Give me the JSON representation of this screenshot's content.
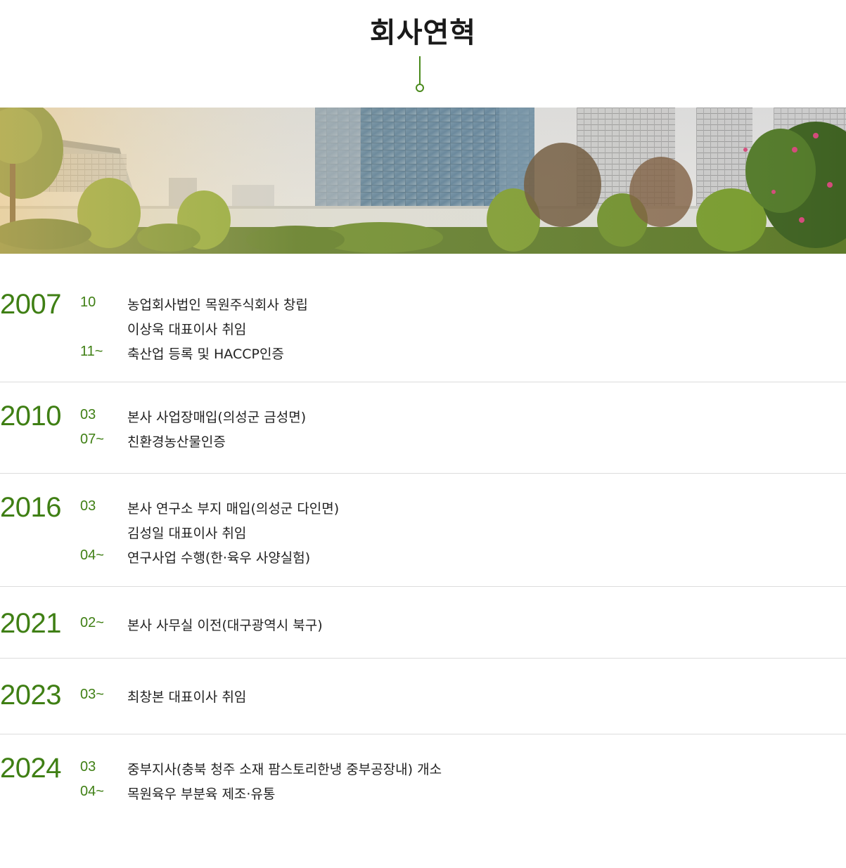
{
  "page": {
    "title": "회사연혁"
  },
  "colors": {
    "accent": "#3f7f14",
    "divider": "#dcdcdc",
    "text": "#222222"
  },
  "banner": {
    "icon": "banner-image"
  },
  "history": [
    {
      "year": "2007",
      "items": [
        {
          "month": "10",
          "text": "농업회사법인 목원주식회사 창립"
        },
        {
          "month": "",
          "text": "이상욱 대표이사 취임"
        },
        {
          "month": "11~",
          "text": "축산업 등록 및 HACCP인증"
        }
      ]
    },
    {
      "year": "2010",
      "items": [
        {
          "month": "03",
          "text": "본사 사업장매입(의성군 금성면)"
        },
        {
          "month": "07~",
          "text": "친환경농산물인증"
        }
      ]
    },
    {
      "year": "2016",
      "items": [
        {
          "month": "03",
          "text": "본사 연구소 부지 매입(의성군 다인면)"
        },
        {
          "month": "",
          "text": "김성일 대표이사 취임"
        },
        {
          "month": "04~",
          "text": "연구사업 수행(한·육우 사양실험)"
        }
      ]
    },
    {
      "year": "2021",
      "items": [
        {
          "month": "02~",
          "text": "본사 사무실 이전(대구광역시 북구)"
        }
      ]
    },
    {
      "year": "2023",
      "items": [
        {
          "month": "03~",
          "text": "최창본 대표이사 취임"
        }
      ]
    },
    {
      "year": "2024",
      "items": [
        {
          "month": "03",
          "text": "중부지사(충북 청주 소재 팜스토리한냉 중부공장내) 개소"
        },
        {
          "month": "04~",
          "text": "목원육우 부분육 제조·유통"
        }
      ]
    }
  ]
}
